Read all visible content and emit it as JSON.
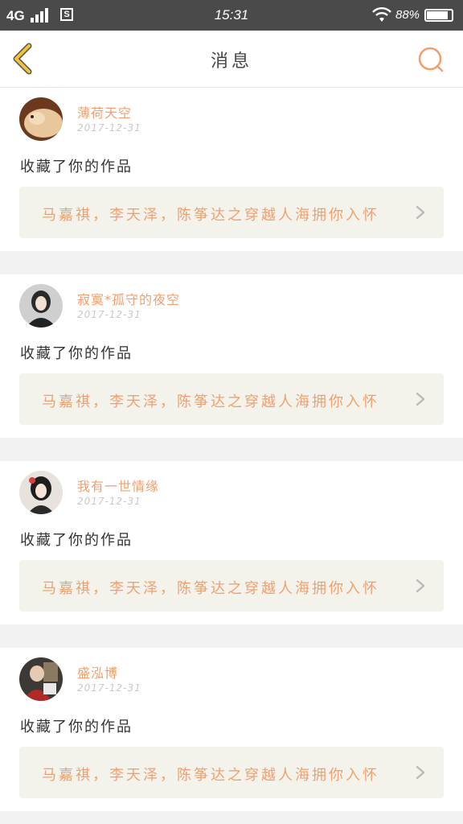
{
  "status_bar": {
    "network": "4G",
    "time": "15:31",
    "battery_percent": "88%",
    "battery_level": 0.88
  },
  "header": {
    "title": "消息",
    "back_icon": "chevron-left-icon",
    "search_icon": "search-icon"
  },
  "colors": {
    "accent": "#f0a070",
    "back_icon": "#f3c43a",
    "work_bg": "#f3f3ec"
  },
  "messages": [
    {
      "username": "薄荷天空",
      "date": "2017-12-31",
      "action": "收藏了你的作品",
      "work_title": "马嘉祺，李天泽，陈筝达之穿越人海拥你入怀"
    },
    {
      "username": "寂寞*孤守的夜空",
      "date": "2017-12-31",
      "action": "收藏了你的作品",
      "work_title": "马嘉祺，李天泽，陈筝达之穿越人海拥你入怀"
    },
    {
      "username": "我有一世情缘",
      "date": "2017-12-31",
      "action": "收藏了你的作品",
      "work_title": "马嘉祺，李天泽，陈筝达之穿越人海拥你入怀"
    },
    {
      "username": "盛泓博",
      "date": "2017-12-31",
      "action": "收藏了你的作品",
      "work_title": "马嘉祺，李天泽，陈筝达之穿越人海拥你入怀"
    }
  ]
}
